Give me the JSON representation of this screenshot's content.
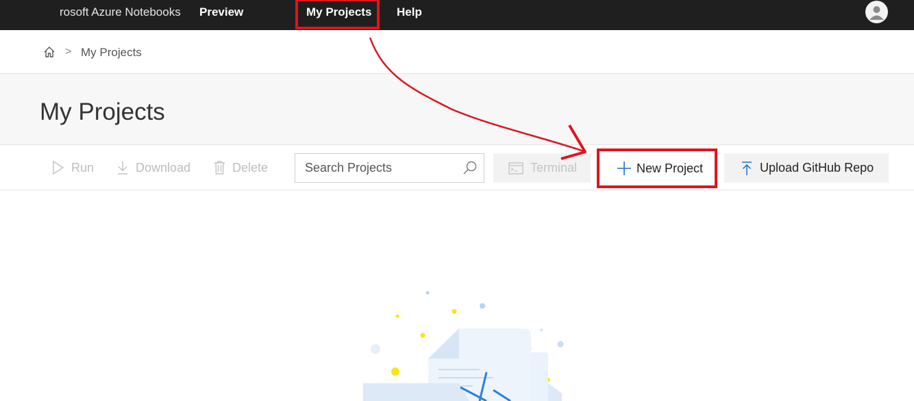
{
  "nav": {
    "brand": "rosoft Azure Notebooks",
    "preview": "Preview",
    "my_projects": "My Projects",
    "help": "Help"
  },
  "breadcrumb": {
    "separator": ">",
    "current": "My Projects"
  },
  "page": {
    "title": "My Projects"
  },
  "toolbar": {
    "run": "Run",
    "download": "Download",
    "delete": "Delete",
    "search_placeholder": "Search Projects",
    "terminal": "Terminal",
    "new_project": "New Project",
    "upload": "Upload GitHub Repo"
  },
  "icons": {
    "home": "home-icon",
    "avatar": "user-avatar-icon",
    "run": "play-icon",
    "download": "download-icon",
    "delete": "trash-icon",
    "search": "search-icon",
    "terminal": "terminal-icon",
    "new_project": "plus-icon",
    "upload": "upload-icon"
  },
  "colors": {
    "topbar": "#1f1f1f",
    "annotation": "#e0141e",
    "accent": "#1a6fd1",
    "disabled": "#bdbdbd"
  }
}
